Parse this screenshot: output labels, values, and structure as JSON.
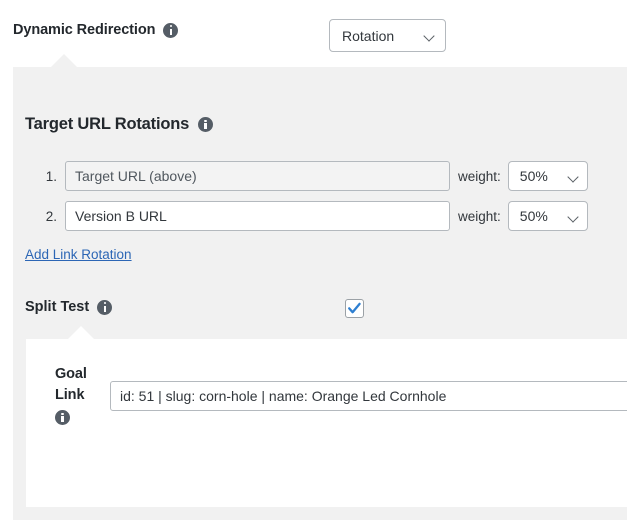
{
  "redirection": {
    "label": "Dynamic Redirection",
    "info_icon": "info-icon",
    "select_value": "Rotation",
    "chevron": "chevron-down-icon"
  },
  "rotations": {
    "title": "Target URL Rotations",
    "info_icon": "info-icon",
    "weight_label": "weight:",
    "rows": [
      {
        "index": "1.",
        "url": "Target URL (above)",
        "weight": "50%",
        "disabled": true
      },
      {
        "index": "2.",
        "url": "Version B URL",
        "weight": "50%",
        "disabled": false
      }
    ],
    "add_link": "Add Link Rotation"
  },
  "split_test": {
    "label": "Split Test",
    "info_icon": "info-icon",
    "checked": true,
    "check_color": "#2e7fd1"
  },
  "goal": {
    "label_line_1": "Goal",
    "label_line_2": "Link",
    "info_icon": "info-icon",
    "value": "id: 51 | slug: corn-hole | name: Orange Led Cornhole"
  },
  "colors": {
    "panel_grey": "#f1f1f1",
    "panel_white": "#ffffff",
    "link_blue": "#2c66b5",
    "border": "#b4b9be",
    "text": "#32373c"
  }
}
